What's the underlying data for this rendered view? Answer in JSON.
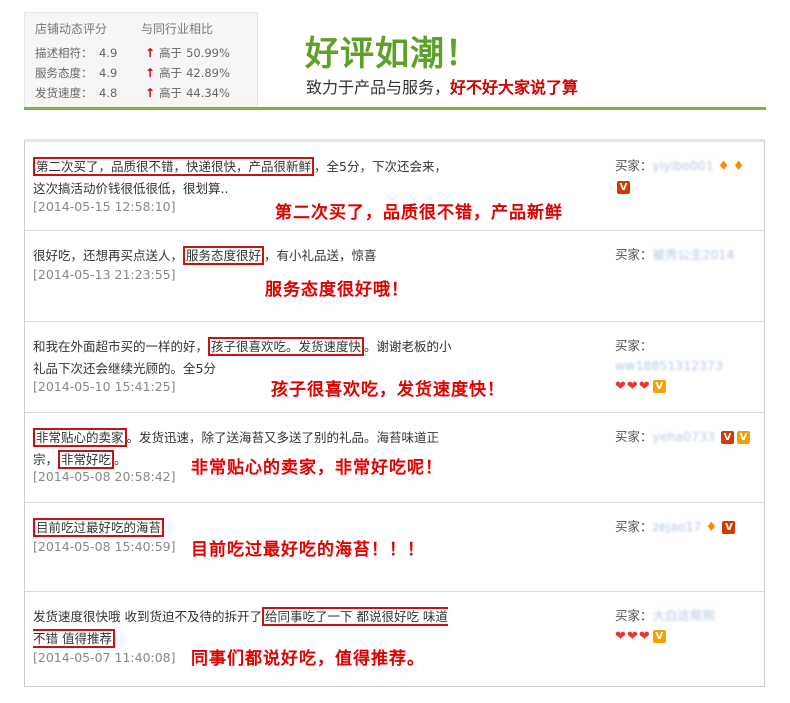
{
  "rating": {
    "header_left": "店铺动态评分",
    "header_right": "与同行业相比",
    "rows": [
      {
        "label": "描述相符：",
        "score": "4.9",
        "higher": "高于",
        "percent": "50.99%"
      },
      {
        "label": "服务态度：",
        "score": "4.9",
        "higher": "高于",
        "percent": "42.89%"
      },
      {
        "label": "发货速度：",
        "score": "4.8",
        "higher": "高于",
        "percent": "44.34%"
      }
    ]
  },
  "headline": {
    "title": "好评如潮！",
    "sub_plain": "致力于产品与服务，",
    "sub_red": "好不好大家说了算"
  },
  "colors": {
    "accent_green": "#5ea028",
    "highlight_red": "#e00000",
    "box_red": "#cc1111",
    "badge_orange": "#f5a000"
  },
  "reviews": [
    {
      "boxed": "第二次买了，品质很不错，快递很快，产品很新鲜",
      "rest": "，全5分，下次还会来，这次搞活动价钱很低很低，很划算..",
      "date": "[2014-05-15 12:58:10]",
      "highlight": "第二次买了，品质很不错，产品新鲜",
      "buyer_label": "买家：",
      "buyer_name": "yiyibo001"
    },
    {
      "pre": "很好吃，还想再买点送人，",
      "boxed": "服务态度很好",
      "rest": "，有小礼品送，惊喜",
      "date": "[2014-05-13 21:23:55]",
      "highlight": "服务态度很好哦！",
      "buyer_label": "买家：",
      "buyer_name": "被秀公主2014"
    },
    {
      "pre": "和我在外面超市买的一样的好，",
      "boxed": "孩子很喜欢吃。发货速度快",
      "rest": "。谢谢老板的小礼品下次还会继续光顾的。全5分",
      "date": "[2014-05-10 15:41:25]",
      "highlight": "孩子很喜欢吃，发货速度快！",
      "buyer_label": "买家：",
      "buyer_name": "ww18851312373"
    },
    {
      "boxed": "非常贴心的卖家",
      "rest": "。发货迅速，除了送海苔又多送了别的礼品。海苔味道正宗，",
      "boxed2": "非常好吃",
      "rest2": "。",
      "date": "[2014-05-08 20:58:42]",
      "highlight": "非常贴心的卖家，非常好吃呢！",
      "buyer_label": "买家：",
      "buyer_name": "yeha0733"
    },
    {
      "boxed": "目前吃过最好吃的海苔",
      "date": "[2014-05-08 15:40:59]",
      "highlight": "目前吃过最好吃的海苔！！！",
      "buyer_label": "买家：",
      "buyer_name": "zejao17"
    },
    {
      "pre": "发货速度很快哦 收到货迫不及待的拆开了",
      "boxed": "给同事吃了一下 都说很好吃 味道不错 值得推荐",
      "date": "[2014-05-07 11:40:08]",
      "highlight": "同事们都说好吃，值得推荐。",
      "buyer_label": "买家：",
      "buyer_name": "大白这帮熊"
    }
  ]
}
